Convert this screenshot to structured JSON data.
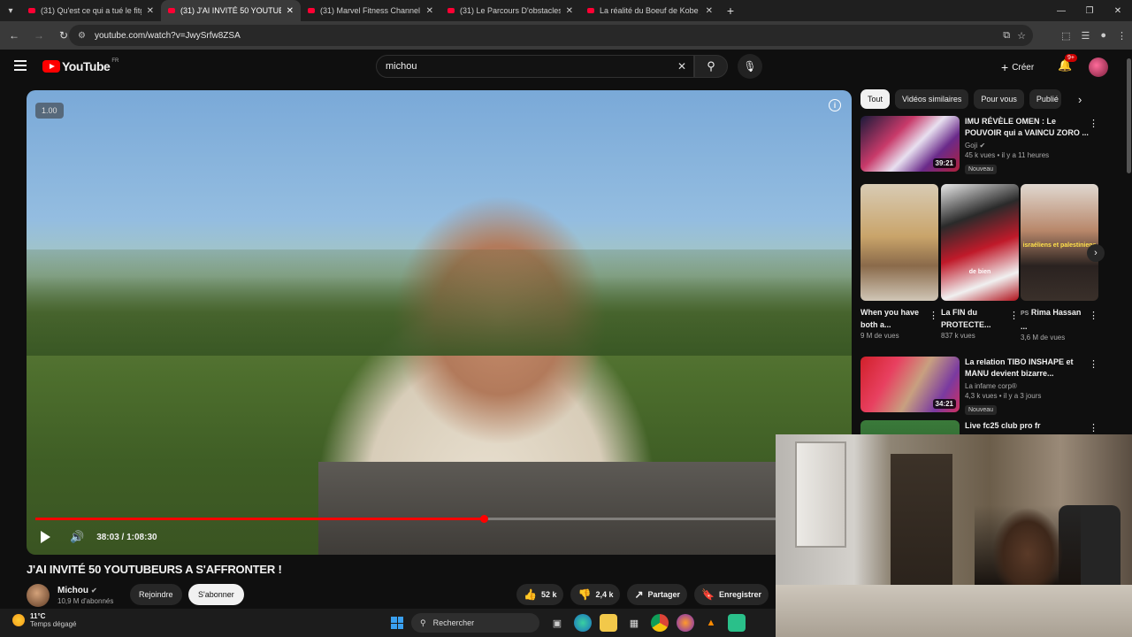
{
  "browser": {
    "tabs": [
      {
        "title": "(31) Qu'est ce qui a tué le fitge…",
        "active": false
      },
      {
        "title": "(31) J'AI INVITÉ 50 YOUTUBEU…",
        "active": true
      },
      {
        "title": "(31) Marvel Fitness Channel - Y…",
        "active": false
      },
      {
        "title": "(31) Le Parcours D'obstacles Le…",
        "active": false
      },
      {
        "title": "La réalité du Boeuf de Kobe jap…",
        "active": false
      }
    ],
    "url": "youtube.com/watch?v=JwySrfw8ZSA"
  },
  "youtube": {
    "logo_text": "YouTube",
    "country": "FR",
    "search_query": "michou",
    "create_label": "Créer",
    "notifications_badge": "9+"
  },
  "player": {
    "speed": "1.00",
    "time": "38:03 / 1:08:30",
    "progress_fraction": 0.555
  },
  "video": {
    "title": "J'AI INVITÉ 50 YOUTUBEURS A S'AFFRONTER !",
    "channel": "Michou",
    "subscribers": "10,9 M d'abonnés",
    "join_label": "Rejoindre",
    "subscribe_label": "S'abonner",
    "likes": "52 k",
    "dislikes": "2,4 k",
    "share_label": "Partager",
    "save_label": "Enregistrer"
  },
  "sidebar": {
    "chips": [
      "Tout",
      "Vidéos similaires",
      "Pour vous",
      "Publié"
    ],
    "recs": [
      {
        "title": "IMU RÉVÈLE OMEN : Le POUVOIR qui a VAINCU ZORO ...",
        "channel": "Goji",
        "stats": "45 k vues • il y a 11 heures",
        "badge": "Nouveau",
        "duration": "39:21"
      },
      {
        "title": "La relation TIBO INSHAPE et MANU devient bizarre...",
        "channel": "La infame corp®",
        "stats": "4,3 k vues • il y a 3 jours",
        "badge": "Nouveau",
        "duration": "34:21"
      },
      {
        "title": "Live fc25 club pro fr",
        "channel": "",
        "stats": "",
        "badge": "",
        "duration": ""
      }
    ],
    "shorts": [
      {
        "title": "When you have both a...",
        "views": "9 M de vues",
        "caption": ""
      },
      {
        "title": "La FIN du PROTECTE...",
        "views": "837 k vues",
        "caption": "de bien"
      },
      {
        "title": "Rima Hassan ...",
        "views": "3,6 M de vues",
        "caption": "israéliens et palestiniens"
      }
    ],
    "short3_prefix": "PS"
  },
  "taskbar": {
    "temperature": "11°C",
    "condition": "Temps dégagé",
    "search_label": "Rechercher"
  }
}
